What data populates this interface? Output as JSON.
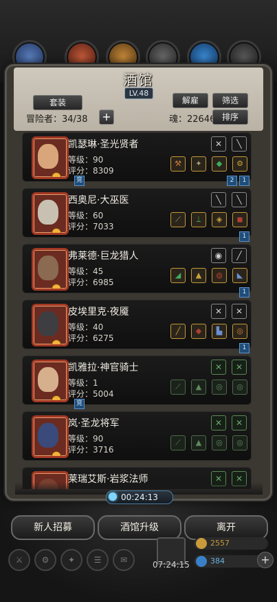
{
  "tavern": {
    "title": "酒馆",
    "level": "LV.48",
    "set_button": "套装",
    "dismiss_button": "解雇",
    "filter_button": "筛选",
    "sort_button": "排序",
    "adventurers": "冒险者：34/38",
    "soul": "魂：22646"
  },
  "heroes": [
    {
      "name": "凯瑟琳·圣光贤者",
      "level": "等级：90",
      "score": "评分：8309",
      "skills": [
        "✕",
        "╲"
      ],
      "equips": [
        "⚒",
        "✦",
        "◆",
        "⚙"
      ],
      "tag": "竞",
      "badges": [
        "2",
        "1"
      ],
      "portrait_color": "#d9a57a"
    },
    {
      "name": "西奥尼·大巫医",
      "level": "等级：60",
      "score": "评分：7033",
      "skills": [
        "╲",
        "╲"
      ],
      "equips": [
        "⟋",
        "⟘",
        "◈",
        "◼"
      ],
      "tag": "",
      "badges": [
        "1"
      ],
      "portrait_color": "#c8c1b2"
    },
    {
      "name": "弗莱德·巨龙猎人",
      "level": "等级：45",
      "score": "评分：6985",
      "skills": [
        "◉",
        "╱"
      ],
      "equips": [
        "◢",
        "▲",
        "◍",
        "◣"
      ],
      "tag": "",
      "badges": [
        "1"
      ],
      "portrait_color": "#8a6a50"
    },
    {
      "name": "皮埃里克·夜魇",
      "level": "等级：40",
      "score": "评分：6275",
      "skills": [
        "✕",
        "✕"
      ],
      "equips": [
        "╱",
        "◆",
        "▙",
        "◎"
      ],
      "tag": "",
      "badges": [
        "1"
      ],
      "portrait_color": "#3e3e42"
    },
    {
      "name": "凯雅拉·神官骑士",
      "level": "等级：1",
      "score": "评分：5004",
      "skills": [
        "✕",
        "✕"
      ],
      "equips": [
        "⟋",
        "▲",
        "◎",
        "◎"
      ],
      "tag": "竞",
      "badges": [],
      "portrait_color": "#d6b08c"
    },
    {
      "name": "岚·圣龙将军",
      "level": "等级：90",
      "score": "评分：3716",
      "skills": [
        "✕",
        "✕"
      ],
      "equips": [
        "⟋",
        "▲",
        "◎",
        "◎"
      ],
      "tag": "",
      "badges": [],
      "portrait_color": "#3a4a7a"
    },
    {
      "name": "莱瑞艾斯·岩浆法师",
      "level": "",
      "score": "",
      "skills": [
        "✕",
        "✕"
      ],
      "equips": [],
      "tag": "",
      "badges": [],
      "portrait_color": "#7a4030"
    }
  ],
  "timer": "00:24:13",
  "bottom": {
    "recruit": "新人招募",
    "upgrade": "酒馆升级",
    "leave": "离开",
    "box_timer": "07:24:15",
    "gold": "2557",
    "gems": "384"
  },
  "colors": {
    "panel": "#3b3731",
    "header": "#c4bdb0",
    "portrait_frame": "#a33824",
    "equip_border": "#c69a3c"
  }
}
